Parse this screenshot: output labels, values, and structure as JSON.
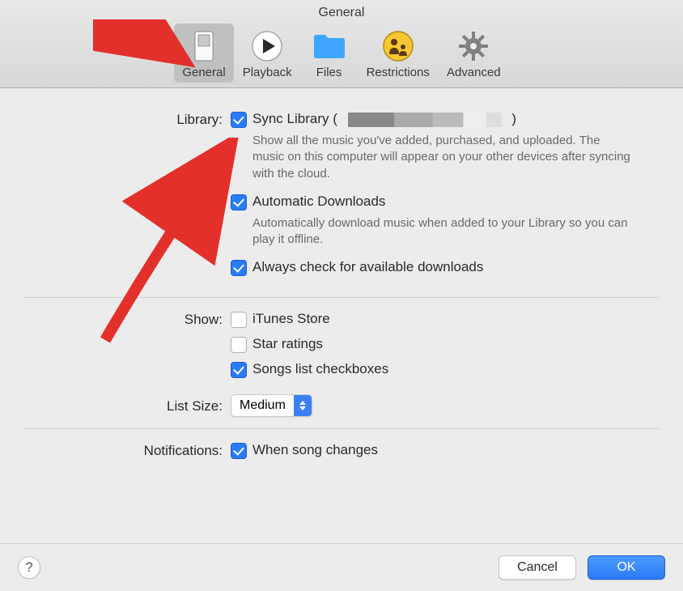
{
  "window": {
    "title": "General"
  },
  "toolbar": {
    "items": [
      {
        "label": "General",
        "selected": true
      },
      {
        "label": "Playback",
        "selected": false
      },
      {
        "label": "Files",
        "selected": false
      },
      {
        "label": "Restrictions",
        "selected": false
      },
      {
        "label": "Advanced",
        "selected": false
      }
    ]
  },
  "sections": {
    "library": {
      "label": "Library:",
      "sync": {
        "checked": true,
        "label_prefix": "Sync Library (",
        "label_suffix": ")",
        "desc": "Show all the music you've added, purchased, and uploaded. The music on this computer will appear on your other devices after syncing with the cloud."
      },
      "auto_downloads": {
        "checked": true,
        "label": "Automatic Downloads",
        "desc": "Automatically download music when added to your Library so you can play it offline."
      },
      "always_check": {
        "checked": true,
        "label": "Always check for available downloads"
      }
    },
    "show": {
      "label": "Show:",
      "itunes_store": {
        "checked": false,
        "label": "iTunes Store"
      },
      "star_ratings": {
        "checked": false,
        "label": "Star ratings"
      },
      "songs_checkboxes": {
        "checked": true,
        "label": "Songs list checkboxes"
      }
    },
    "list_size": {
      "label": "List Size:",
      "value": "Medium"
    },
    "notifications": {
      "label": "Notifications:",
      "song_changes": {
        "checked": true,
        "label": "When song changes"
      }
    }
  },
  "footer": {
    "help": "?",
    "cancel": "Cancel",
    "ok": "OK"
  }
}
